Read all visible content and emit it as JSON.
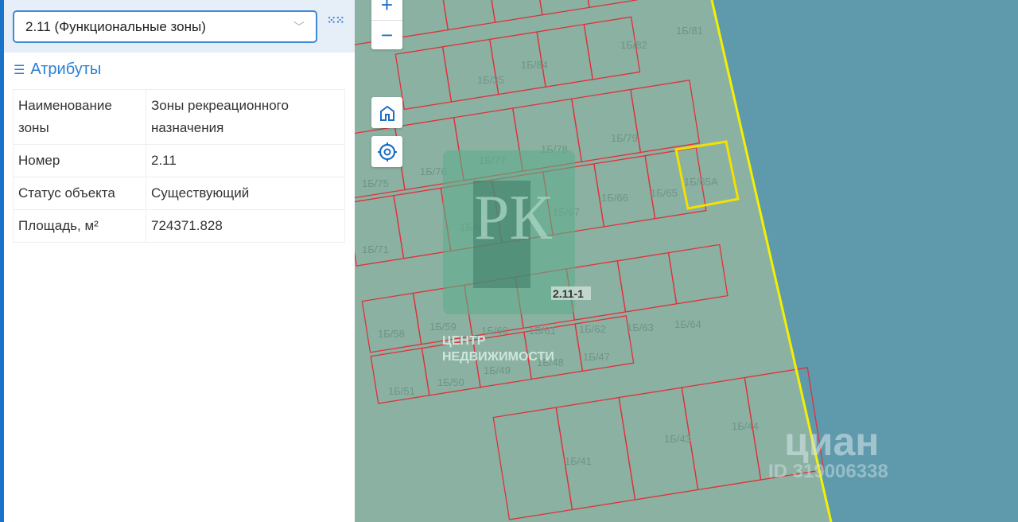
{
  "panel": {
    "layer_select": "2.11 (Функциональные зоны)",
    "attributes_title": "Атрибуты",
    "attributes": [
      {
        "name": "Наименование зоны",
        "value": "Зоны рекреационного назначения"
      },
      {
        "name": "Номер",
        "value": "2.11"
      },
      {
        "name": "Статус объекта",
        "value": "Существующий"
      },
      {
        "name": "Площадь, м²",
        "value": "724371.828"
      }
    ]
  },
  "map": {
    "zone_label": "2.11-1",
    "parcels": [
      "1Б/81",
      "1Б/82",
      "1Б/84",
      "1Б/35",
      "1Б/79",
      "1Б/78",
      "1Б/77",
      "1Б/76",
      "1Б/75",
      "1Б/66",
      "1Б/65",
      "1Б/65А",
      "1Б/67",
      "1Б/69",
      "1Б/71",
      "1Б/58",
      "1Б/59",
      "1Б/60",
      "1Б/61",
      "1Б/62",
      "1Б/63",
      "1Б/64",
      "1Б/49",
      "1Б/48",
      "1Б/47",
      "1Б/51",
      "1Б/50",
      "1Б/43",
      "1Б/44",
      "1Б/41"
    ],
    "colors": {
      "land": "#8bb1a2",
      "water": "#5e9aab",
      "parcel": "#e0303a",
      "boundary": "#f5f000"
    }
  },
  "watermarks": {
    "logo_letters": "РК",
    "logo_text_1": "ЦЕНТР",
    "logo_text_2": "НЕДВИЖИМОСТИ",
    "cian": "циан",
    "cian_id": "ID 319006338"
  }
}
